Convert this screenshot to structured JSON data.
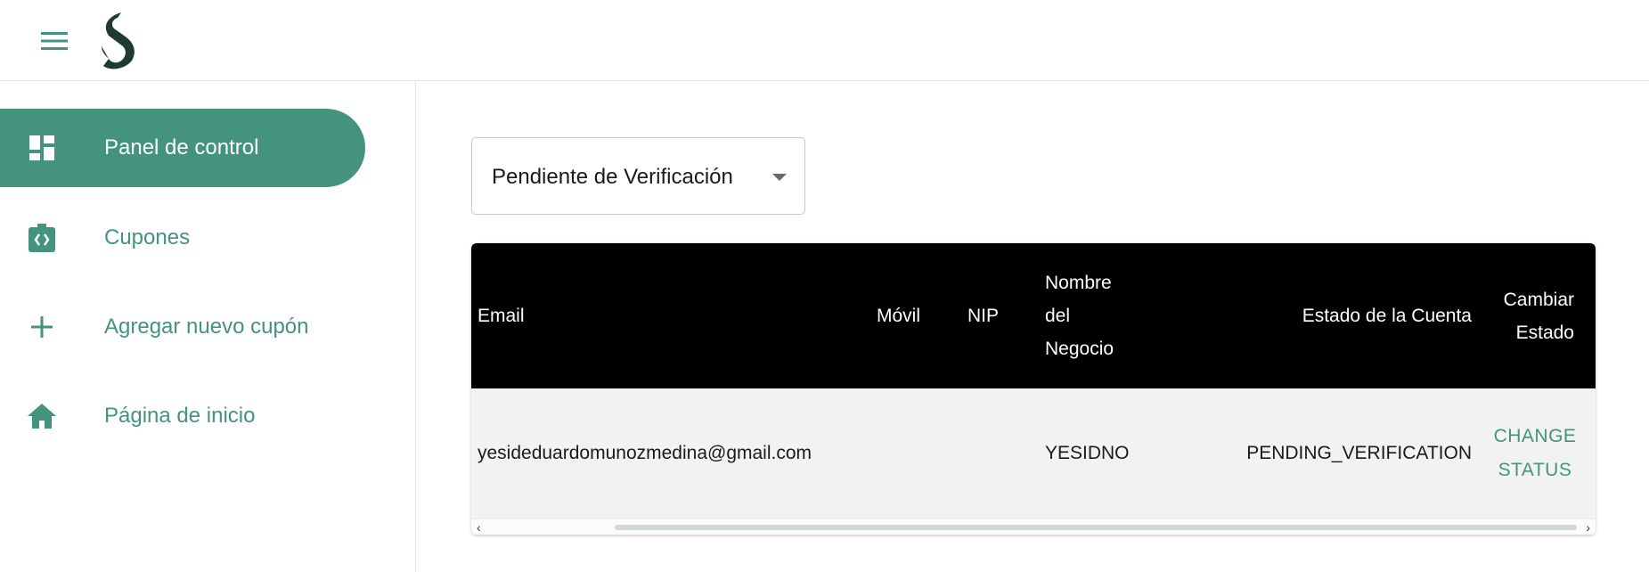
{
  "header": {
    "menu_icon": "hamburger-menu-icon",
    "logo_icon": "brand-s-logo"
  },
  "sidebar": {
    "items": [
      {
        "label": "Panel de control",
        "icon": "dashboard-icon",
        "active": true
      },
      {
        "label": "Cupones",
        "icon": "coupon-icon",
        "active": false
      },
      {
        "label": "Agregar nuevo cupón",
        "icon": "plus-icon",
        "active": false
      },
      {
        "label": "Página de inicio",
        "icon": "home-icon",
        "active": false
      }
    ]
  },
  "filter": {
    "selected": "Pendiente de Verificación"
  },
  "table": {
    "headers": {
      "email": "Email",
      "mobile": "Móvil",
      "nip": "NIP",
      "business_line1": "Nombre",
      "business_line2": "del",
      "business_line3": "Negocio",
      "status": "Estado de la Cuenta",
      "change_line1": "Cambiar",
      "change_line2": "Estado"
    },
    "rows": [
      {
        "email": "yesideduardomunozmedina@gmail.com",
        "mobile": "",
        "nip": "",
        "business": "YESIDNO",
        "status": "PENDING_VERIFICATION",
        "action_line1": "CHANGE",
        "action_line2": "STATUS"
      }
    ]
  },
  "colors": {
    "accent": "#43937e",
    "header_bg": "#000000",
    "row_bg": "#f2f2f2",
    "logo": "#1f3a33"
  }
}
